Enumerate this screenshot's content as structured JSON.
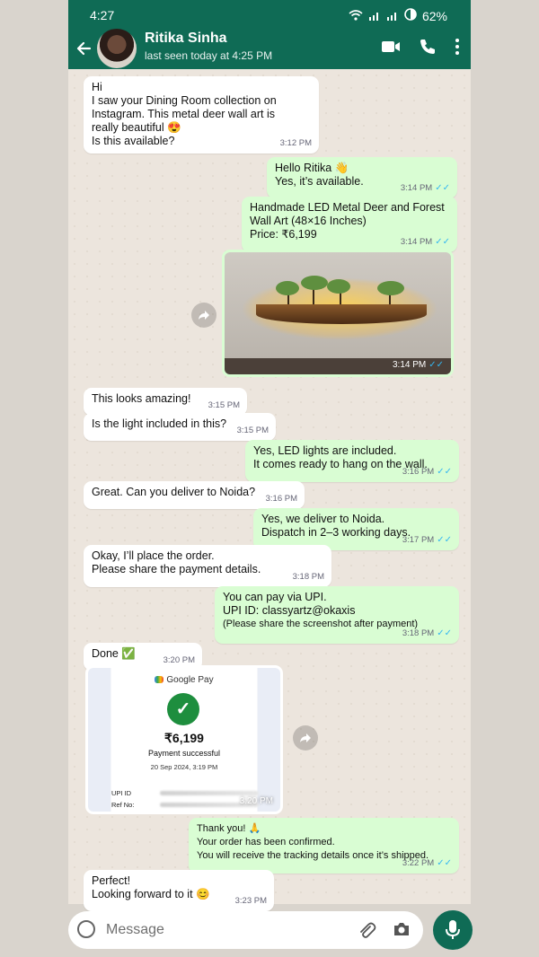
{
  "status_bar": {
    "time": "4:27",
    "battery": "62%"
  },
  "header": {
    "contact_name": "Ritika Sinha",
    "last_seen": "last seen today at 4:25 PM"
  },
  "messages": [
    {
      "lines": [
        "Hi",
        "I saw your Dining Room collection on",
        "Instagram. This metal deer wall art is",
        "really beautiful 😍",
        "Is this available?"
      ],
      "time": "3:12 PM"
    },
    {
      "lines": [
        "Hello Ritika 👋",
        "Yes, it’s available."
      ],
      "time": "3:14 PM"
    },
    {
      "lines": [
        "Handmade LED Metal Deer and Forest",
        "Wall Art (48×16 Inches)",
        "Price: ₹6,199"
      ],
      "time": "3:14 PM"
    },
    {
      "time": "3:14 PM"
    },
    {
      "lines": [
        "This looks amazing!"
      ],
      "time": "3:15 PM"
    },
    {
      "lines": [
        "Is the light included in this?"
      ],
      "time": "3:15 PM"
    },
    {
      "lines": [
        "Yes, LED lights are included.",
        "It comes ready to hang on the wall."
      ],
      "time": "3:16 PM"
    },
    {
      "lines": [
        "Great. Can you deliver to Noida?"
      ],
      "time": "3:16 PM"
    },
    {
      "lines": [
        "Yes, we deliver to Noida.",
        "Dispatch in 2–3 working days."
      ],
      "time": "3:17 PM"
    },
    {
      "lines": [
        "Okay, I’ll place the order.",
        "Please share the payment details."
      ],
      "time": "3:18 PM"
    },
    {
      "lines": [
        "You can pay via UPI.",
        "UPI ID: classyartz@okaxis",
        "(Please share the screenshot after payment)"
      ],
      "time": "3:18 PM"
    },
    {
      "lines": [
        "Done ✅"
      ],
      "time": "3:20 PM"
    },
    {
      "gpay": {
        "brand": "Google Pay",
        "amount": "₹6,199",
        "status": "Payment successful",
        "date": "20 Sep 2024, 3:19 PM",
        "upi_label": "UPI ID",
        "ref_label": "Ref No:"
      },
      "time": "3:20 PM"
    },
    {
      "lines": [
        "Thank you! 🙏",
        "Your order has been confirmed.",
        "You will receive the tracking details once it’s shipped."
      ],
      "time": "3:22 PM"
    },
    {
      "lines": [
        "Perfect!",
        "Looking forward to it 😊"
      ],
      "time": "3:23 PM"
    }
  ],
  "composer": {
    "placeholder": "Message"
  },
  "colors": {
    "header": "#0f6b55",
    "outgoing": "#d9fdd3",
    "incoming": "#ffffff",
    "read_tick": "#34b7f1"
  }
}
